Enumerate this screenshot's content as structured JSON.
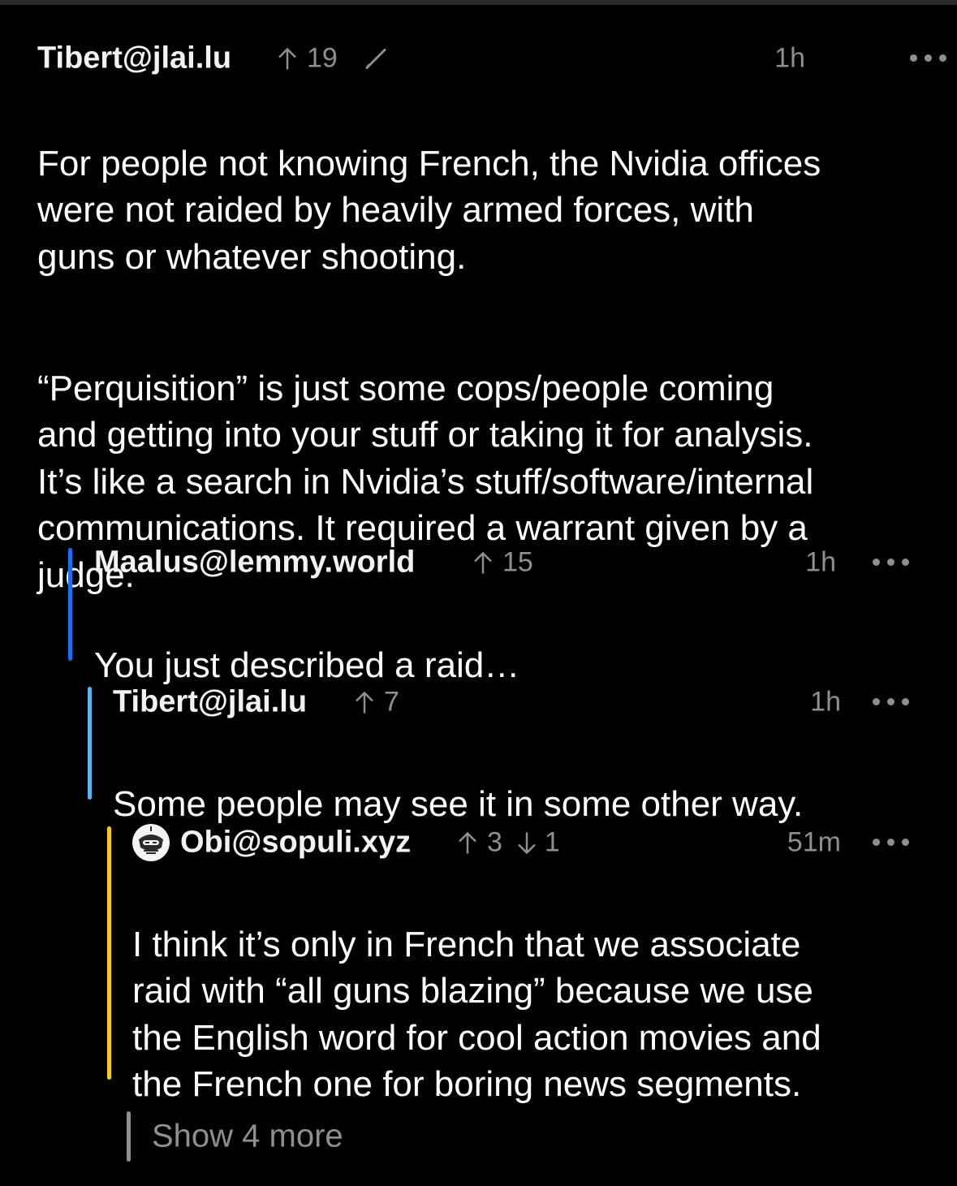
{
  "comments": [
    {
      "author": "Tibert@jlai.lu",
      "upvotes": "19",
      "edited": true,
      "time": "1h",
      "paragraphs": [
        "For people not knowing French, the Nvidia offices\nwere not raided by heavily armed forces, with\nguns or whatever shooting.",
        "“Perquisition” is just some cops/people coming\nand getting into your stuff or taking it for analysis.\nIt’s like a search in Nvidia’s stuff/software/internal\ncommunications. It required a warrant given by a\njudge."
      ]
    },
    {
      "author": "Maalus@lemmy.world",
      "upvotes": "15",
      "time": "1h",
      "thread_color": "#1a6ff0",
      "paragraphs": [
        "You just described a raid…"
      ]
    },
    {
      "author": "Tibert@jlai.lu",
      "upvotes": "7",
      "time": "1h",
      "thread_color": "#5ab4f0",
      "paragraphs": [
        "Some people may see it in some other way."
      ]
    },
    {
      "author": "Obi@sopuli.xyz",
      "upvotes": "3",
      "downvotes": "1",
      "time": "51m",
      "thread_color": "#f5cc16",
      "avatar_icon": "robot-avatar-icon",
      "paragraphs": [
        "I think it’s only in French that we associate\nraid with “all guns blazing” because we use\nthe English word for cool action movies and\nthe French one for boring news segments."
      ]
    }
  ],
  "show_more": {
    "label": "Show 4 more",
    "thread_color": "#8e8e93"
  }
}
